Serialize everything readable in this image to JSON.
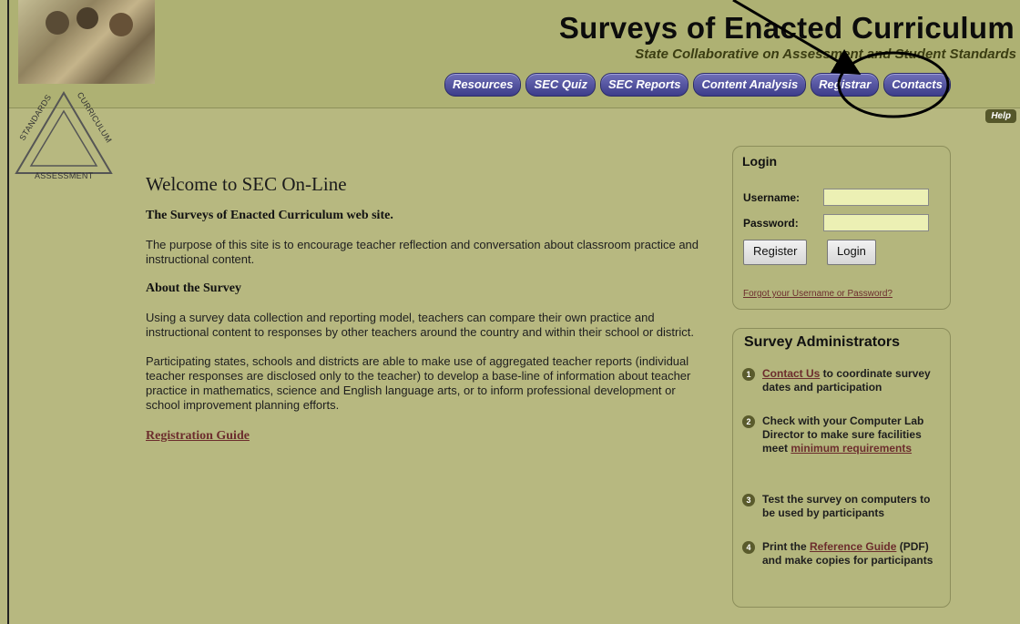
{
  "header": {
    "title": "Surveys of Enacted Curriculum",
    "subtitle": "State Collaborative on Assessment and Student Standards",
    "nav": [
      "Resources",
      "SEC Quiz",
      "SEC Reports",
      "Content Analysis",
      "Registrar",
      "Contacts"
    ],
    "help": "Help"
  },
  "logo": {
    "top": "STANDARDS",
    "right": "CURRICULUM",
    "bottom": "ASSESSMENT"
  },
  "main": {
    "title": "Welcome to SEC On-Line",
    "subtitle": "The Surveys of Enacted Curriculum web site.",
    "intro": "The purpose of this site is to encourage teacher reflection and conversation about classroom practice and instructional content.",
    "about_heading": "About the Survey",
    "about_p1": "Using a survey data collection and reporting model, teachers can compare their own practice and instructional content to responses by other teachers around the country and within their school or district.",
    "about_p2": "Participating states, schools and districts are able to make use of aggregated teacher reports (individual teacher responses are disclosed only to the teacher) to develop a base-line of information about teacher practice in mathematics, science and English language arts, or to inform professional development or school improvement planning efforts.",
    "registration_link": "Registration Guide"
  },
  "login": {
    "title": "Login",
    "username_label": "Username:",
    "password_label": "Password:",
    "register_button": "Register",
    "login_button": "Login",
    "forgot": "Forgot your Username or Password?"
  },
  "admin": {
    "title": "Survey Administrators",
    "step1_link": "Contact Us",
    "step1_text": " to coordinate survey dates and participation",
    "step2_text": "Check with your Computer Lab Director to make sure facilities meet ",
    "step2_link": "minimum requirements",
    "step3_text": "Test the survey on computers to be used by participants",
    "step4_pre": "Print the ",
    "step4_link": "Reference Guide",
    "step4_text": " (PDF) and make copies for participants"
  },
  "colors": {
    "background": "#b7b880",
    "nav_button": "#4a4a9a",
    "link": "#6c2d2d"
  }
}
